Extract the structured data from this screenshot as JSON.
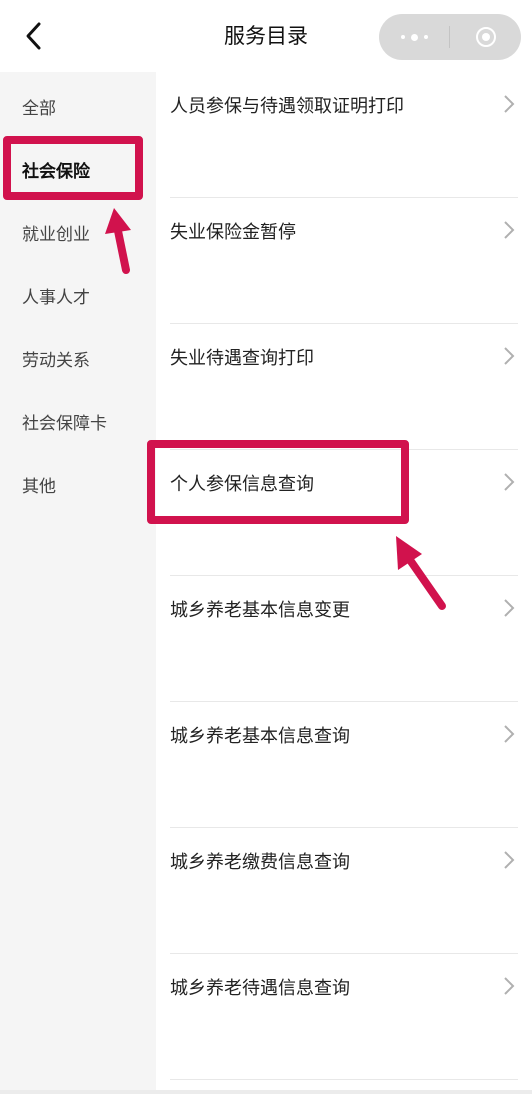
{
  "header": {
    "title": "服务目录"
  },
  "sidebar": {
    "items": [
      {
        "label": "全部"
      },
      {
        "label": "社会保险"
      },
      {
        "label": "就业创业"
      },
      {
        "label": "人事人才"
      },
      {
        "label": "劳动关系"
      },
      {
        "label": "社会保障卡"
      },
      {
        "label": "其他"
      }
    ],
    "active_index": 1
  },
  "services": [
    {
      "label": "人员参保与待遇领取证明打印"
    },
    {
      "label": "失业保险金暂停"
    },
    {
      "label": "失业待遇查询打印"
    },
    {
      "label": "个人参保信息查询"
    },
    {
      "label": "城乡养老基本信息变更"
    },
    {
      "label": "城乡养老基本信息查询"
    },
    {
      "label": "城乡养老缴费信息查询"
    },
    {
      "label": "城乡养老待遇信息查询"
    }
  ],
  "annotations": {
    "highlight_color": "#d1124d"
  },
  "colors": {
    "sidebar_bg": "#f5f5f5",
    "capsule_bg": "#d9d9d9",
    "divider": "#e8e8e8"
  }
}
